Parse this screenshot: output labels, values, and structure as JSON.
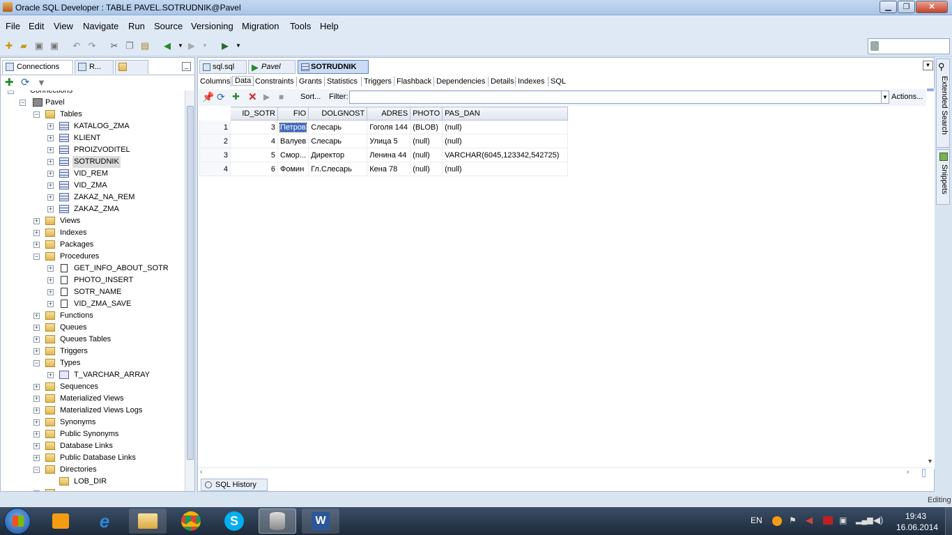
{
  "window": {
    "title": "Oracle SQL Developer : TABLE PAVEL.SOTRUDNIK@Pavel"
  },
  "menu": [
    "File",
    "Edit",
    "View",
    "Navigate",
    "Run",
    "Source",
    "Versioning",
    "Migration",
    "Tools",
    "Help"
  ],
  "left_panel": {
    "tabs": [
      "Connections",
      "R...",
      ""
    ],
    "tree": {
      "partial_top": "Connections",
      "connection": "Pavel",
      "tables_label": "Tables",
      "tables": [
        "KATALOG_ZMA",
        "KLIENT",
        "PROIZVODITEL",
        "SOTRUDNIK",
        "VID_REM",
        "VID_ZMA",
        "ZAKAZ_NA_REM",
        "ZAKAZ_ZMA"
      ],
      "after_tables": [
        "Views",
        "Indexes",
        "Packages"
      ],
      "procedures_label": "Procedures",
      "procedures": [
        "GET_INFO_ABOUT_SOTR",
        "PHOTO_INSERT",
        "SOTR_NAME",
        "VID_ZMA_SAVE"
      ],
      "mid_folders": [
        "Functions",
        "Queues",
        "Queues Tables",
        "Triggers"
      ],
      "types_label": "Types",
      "types": [
        "T_VARCHAR_ARRAY"
      ],
      "lower_folders": [
        "Sequences",
        "Materialized Views",
        "Materialized Views Logs",
        "Synonyms",
        "Public Synonyms",
        "Database Links",
        "Public Database Links"
      ],
      "directories_label": "Directories",
      "directories": [
        "LOB_DIR"
      ]
    }
  },
  "editor": {
    "tabs": [
      "sql.sql",
      "Pavel",
      "SOTRUDNIK"
    ],
    "subtabs": [
      "Columns",
      "Data",
      "Constraints",
      "Grants",
      "Statistics",
      "Triggers",
      "Flashback",
      "Dependencies",
      "Details",
      "Indexes",
      "SQL"
    ],
    "active_subtab": "Data",
    "toolbar": {
      "sort_label": "Sort...",
      "filter_label": "Filter:",
      "actions_label": "Actions..."
    },
    "grid": {
      "columns": [
        "ID_SOTR",
        "FIO",
        "DOLGNOST",
        "ADRES",
        "PHOTO",
        "PAS_DAN"
      ],
      "rows": [
        {
          "n": "1",
          "cells": [
            "3",
            "Петров",
            "Слесарь",
            "Гоголя 144",
            "(BLOB)",
            "(null)"
          ]
        },
        {
          "n": "2",
          "cells": [
            "4",
            "Валуев",
            "Слесарь",
            "Улица 5",
            "(null)",
            "(null)"
          ]
        },
        {
          "n": "3",
          "cells": [
            "5",
            "Смор...",
            "Директор",
            "Ленина 44",
            "(null)",
            "VARCHAR(6045,123342,542725)"
          ]
        },
        {
          "n": "4",
          "cells": [
            "6",
            "Фомин",
            "Гл.Слесарь",
            "Кена 78",
            "(null)",
            "(null)"
          ]
        }
      ]
    },
    "bottom_tab": "SQL History"
  },
  "right_sidebar": [
    "Extended Search",
    "Snippets"
  ],
  "status": {
    "mode": "Editing"
  },
  "taskbar": {
    "lang": "EN",
    "time": "19:43",
    "date": "16.06.2014"
  },
  "colors": {
    "accent": "#3f6cc4",
    "chrome": "#dfe9f5"
  }
}
